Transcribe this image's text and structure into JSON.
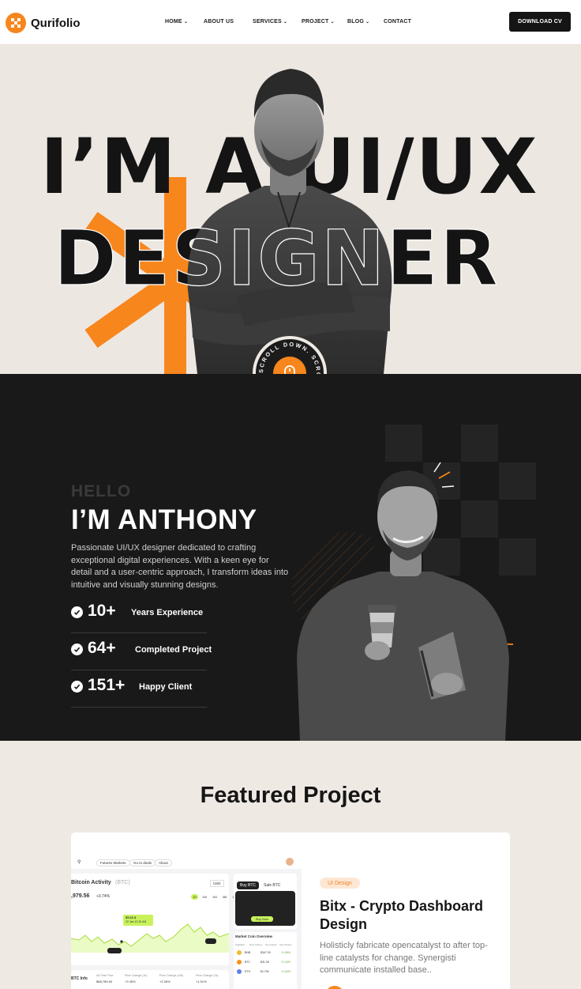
{
  "brand": {
    "name": "Qurifolio",
    "accent": "#f7861c",
    "dark": "#191919",
    "logo_icon": "checker-icon"
  },
  "nav": {
    "items": [
      {
        "label": "HOME",
        "dropdown": true
      },
      {
        "label": "ABOUT US",
        "dropdown": false
      },
      {
        "label": "SERVICES",
        "dropdown": true
      },
      {
        "label": "PROJECT",
        "dropdown": true
      },
      {
        "label": "BLOG",
        "dropdown": true
      },
      {
        "label": "CONTACT",
        "dropdown": false
      }
    ],
    "cta": "DOWNLOAD CV"
  },
  "hero": {
    "line1": "I’M A UI/UX",
    "line2": "DESIGNER",
    "scroll_text": "SCROLL DOWN. SCROLL DOWN.",
    "scroll_icon": "mouse-icon"
  },
  "about": {
    "hello": "HELLO",
    "name": "I’M ANTHONY",
    "description": "Passionate UI/UX designer dedicated to crafting exceptional digital experiences. With a keen eye for detail and a user-centric approach, I transform ideas into intuitive and visually stunning designs.",
    "stats": [
      {
        "value": "10+",
        "label": "Years Experience"
      },
      {
        "value": "64+",
        "label": "Completed Project"
      },
      {
        "value": "151+",
        "label": "Happy Client"
      }
    ]
  },
  "featured": {
    "title": "Featured Project",
    "project": {
      "tag": "UI Design",
      "title": "Bitx - Crypto Dashboard Design",
      "description": "Holisticly fabricate opencatalyst to after top-line catalysts for change. Synergisti communicate installed base.."
    },
    "dashboard": {
      "tabs": [
        "Futures Markets",
        "Go to deals",
        "About"
      ],
      "chart_title": "Bitcoin Activity",
      "chart_ticker": "(BTC)",
      "currency": "USD",
      "price": ",979.56",
      "change": "+3.74%",
      "tooltip_price": "55.63 $",
      "tooltip_date": "22 Jan 12:30 AM",
      "ranges": [
        "1D",
        "1W",
        "1M",
        "3M",
        "1Y"
      ],
      "buy_tab": "Buy BTC",
      "sell_tab": "Sale BTC",
      "buy_button": "Buy Now",
      "overview_title": "Market Coin Overview",
      "overview_tabs": [
        "Highlight",
        "New Listing",
        "Top Gainer",
        "Top Volume"
      ],
      "coins": [
        {
          "symbol": "BNB",
          "price": "$347.30",
          "change": "+1.09%"
        },
        {
          "symbol": "BTC",
          "price": "$31.2K",
          "change": "+1.12%"
        },
        {
          "symbol": "ETH",
          "price": "$1.70k",
          "change": "+1.04%"
        }
      ],
      "table_label": "BTC Info",
      "table_headers": [
        "All Time Price",
        "Price Change (1h)",
        "Price Change (24h)",
        "Price Change (7d)"
      ],
      "table_values": [
        "$68,789.63",
        "+2.45%",
        "+2.28%",
        "+1.51%"
      ]
    }
  }
}
